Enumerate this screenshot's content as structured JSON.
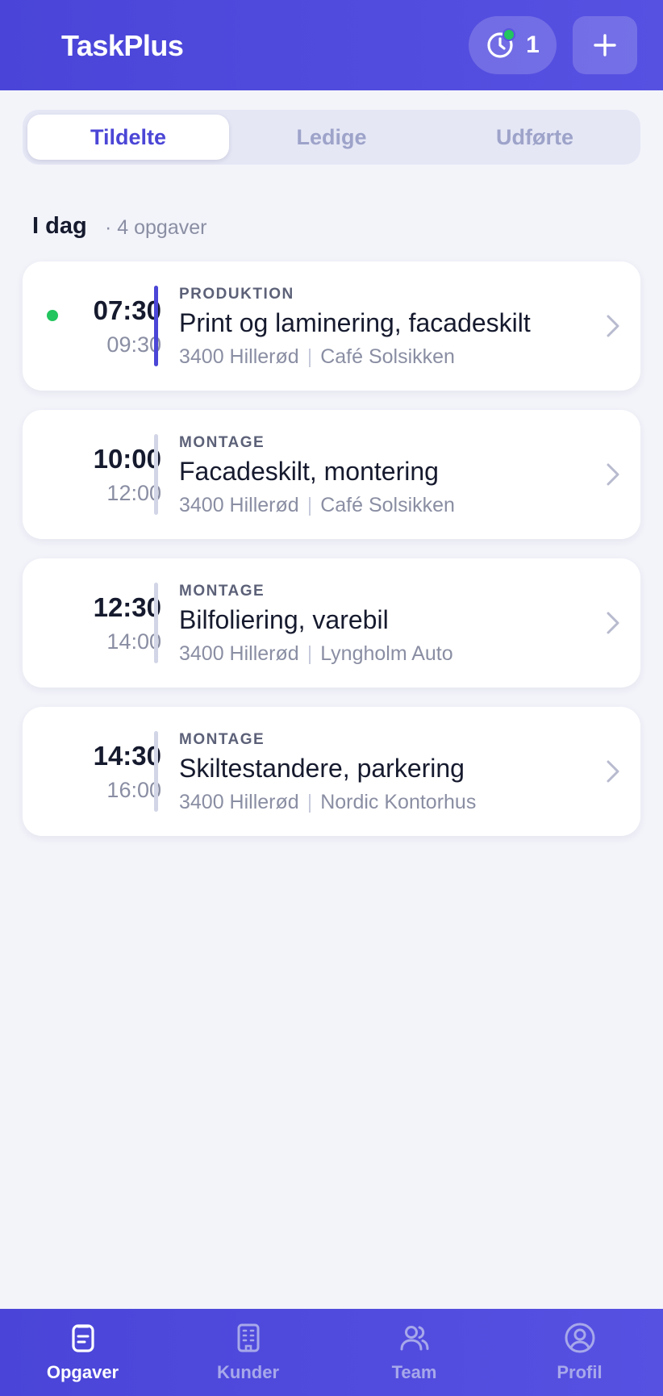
{
  "header": {
    "title": "TaskPlus",
    "timer_icon": "clock-icon",
    "timer_count": "1",
    "add_icon": "plus-icon"
  },
  "tabs": [
    {
      "label": "Tildelte",
      "active": true
    },
    {
      "label": "Ledige",
      "active": false
    },
    {
      "label": "Udførte",
      "active": false
    }
  ],
  "section": {
    "title": "I dag",
    "count": "· 4 opgaver"
  },
  "tasks": [
    {
      "start": "07:30",
      "end": "09:30",
      "category": "PRODUKTION",
      "title": "Print og laminering, facadeskilt",
      "location": "3400 Hillerød",
      "customer": "Café Solsikken",
      "in_progress": true
    },
    {
      "start": "10:00",
      "end": "12:00",
      "category": "MONTAGE",
      "title": "Facadeskilt, montering",
      "location": "3400 Hillerød",
      "customer": "Café Solsikken",
      "in_progress": false
    },
    {
      "start": "12:30",
      "end": "14:00",
      "category": "MONTAGE",
      "title": "Bilfoliering, varebil",
      "location": "3400 Hillerød",
      "customer": "Lyngholm Auto",
      "in_progress": false
    },
    {
      "start": "14:30",
      "end": "16:00",
      "category": "MONTAGE",
      "title": "Skiltestandere, parkering",
      "location": "3400 Hillerød",
      "customer": "Nordic Kontorhus",
      "in_progress": false
    }
  ],
  "nav": [
    {
      "label": "Opgaver",
      "icon": "clipboard-icon",
      "active": true
    },
    {
      "label": "Kunder",
      "icon": "building-icon",
      "active": false
    },
    {
      "label": "Team",
      "icon": "users-icon",
      "active": false
    },
    {
      "label": "Profil",
      "icon": "user-circle-icon",
      "active": false
    }
  ],
  "colors": {
    "primary": "#4b46d6",
    "active_status": "#22c55e",
    "background": "#f3f4fa"
  }
}
